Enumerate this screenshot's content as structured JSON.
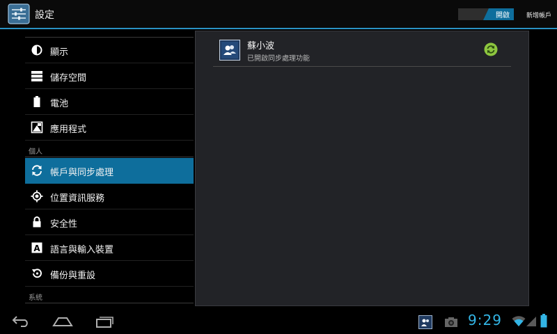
{
  "header": {
    "title": "設定",
    "toggle_label": "開啟",
    "add_account": "新增帳戶"
  },
  "sidebar": {
    "items": [
      {
        "label": "顯示",
        "icon": "brightness-icon"
      },
      {
        "label": "儲存空間",
        "icon": "storage-icon"
      },
      {
        "label": "電池",
        "icon": "battery-icon"
      },
      {
        "label": "應用程式",
        "icon": "apps-icon"
      },
      {
        "label": "帳戶與同步處理",
        "icon": "sync-icon",
        "selected": true
      },
      {
        "label": "位置資訊服務",
        "icon": "location-icon"
      },
      {
        "label": "安全性",
        "icon": "lock-icon"
      },
      {
        "label": "語言與輸入裝置",
        "icon": "language-icon"
      },
      {
        "label": "備份與重設",
        "icon": "backup-icon"
      }
    ],
    "sections": {
      "personal": "個人",
      "system": "系統"
    }
  },
  "account": {
    "name": "蘇小波",
    "status": "已開啟同步處理功能"
  },
  "status_bar": {
    "time": "9:29"
  },
  "colors": {
    "accent": "#33b5e5",
    "selected": "#0e6e9c",
    "sync_green": "#8dc63f"
  }
}
